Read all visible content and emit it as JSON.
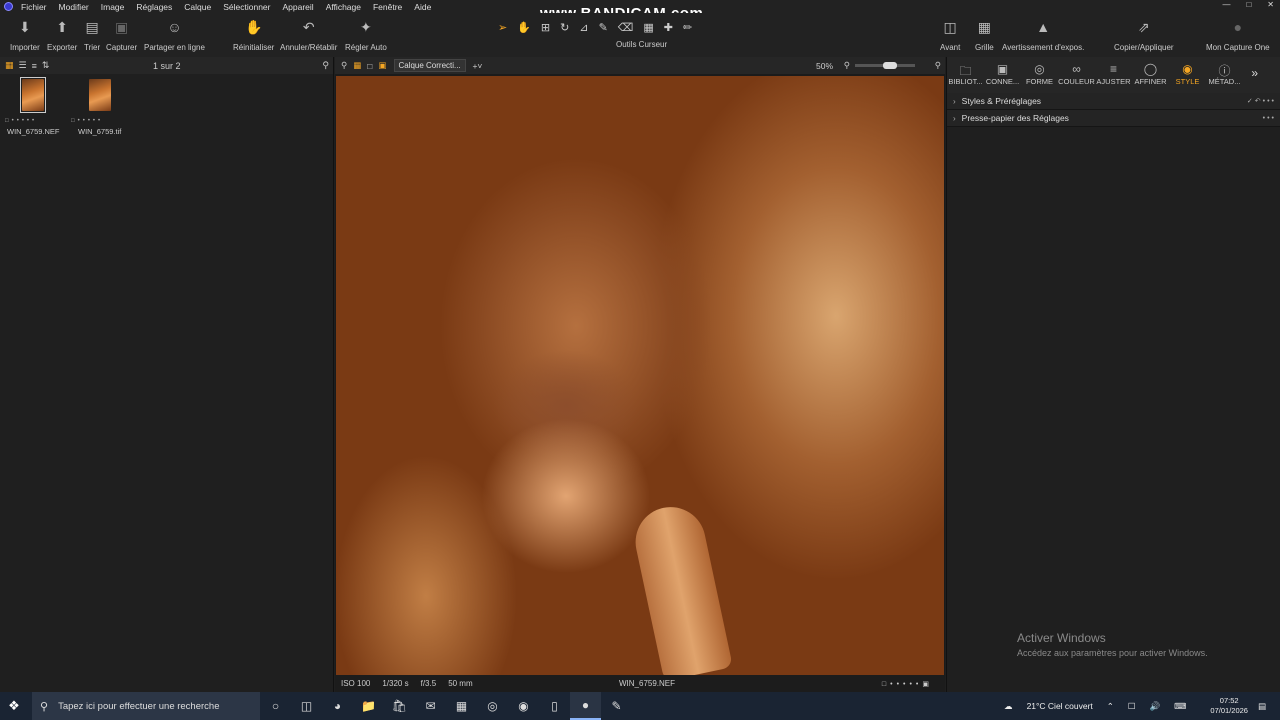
{
  "watermark": "www.BANDICAM.com",
  "menu": [
    "Fichier",
    "Modifier",
    "Image",
    "Réglages",
    "Calque",
    "Sélectionner",
    "Appareil",
    "Affichage",
    "Fenêtre",
    "Aide"
  ],
  "toolbar": {
    "import": "Importer",
    "export": "Exporter",
    "sort": "Trier",
    "capture": "Capturer",
    "share": "Partager en ligne",
    "reset": "Réinitialiser",
    "undo_redo": "Annuler/Rétablir",
    "auto_adjust": "Régler Auto",
    "cursor_tools": "Outils Curseur",
    "before": "Avant",
    "grid": "Grille",
    "exposure_warning": "Avertissement d'expos.",
    "copy_apply": "Copier/Appliquer",
    "my_capture_one": "Mon Capture One"
  },
  "browser": {
    "count": "1 sur 2",
    "thumbs": [
      {
        "name": "WIN_6759.NEF",
        "selected": true
      },
      {
        "name": "WIN_6759.tif",
        "selected": false
      }
    ]
  },
  "viewer": {
    "layer": "Calque Correcti...",
    "zoom": "50%",
    "zoom_level": 0.5,
    "status": {
      "iso": "ISO 100",
      "shutter": "1/320 s",
      "aperture": "f/3.5",
      "focal": "50 mm",
      "filename": "WIN_6759.NEF"
    }
  },
  "tools": {
    "tabs": [
      "BIBLIOT...",
      "CONNE...",
      "FORME",
      "COULEUR",
      "AJUSTER",
      "AFFINER",
      "STYLE",
      "MÉTAD..."
    ],
    "active_tab": "STYLE",
    "panels": [
      "Styles & Préréglages",
      "Presse-papier des Réglages"
    ]
  },
  "activation": {
    "title": "Activer Windows",
    "subtitle": "Accédez aux paramètres pour activer Windows."
  },
  "taskbar": {
    "search_placeholder": "Tapez ici pour effectuer une recherche",
    "weather": "21°C  Ciel couvert",
    "time": "07:52",
    "date": "07/01/2026"
  },
  "colors": {
    "accent": "#f5a623",
    "panel_bg": "#1f1f1f",
    "taskbar_bg": "#1a2433"
  }
}
